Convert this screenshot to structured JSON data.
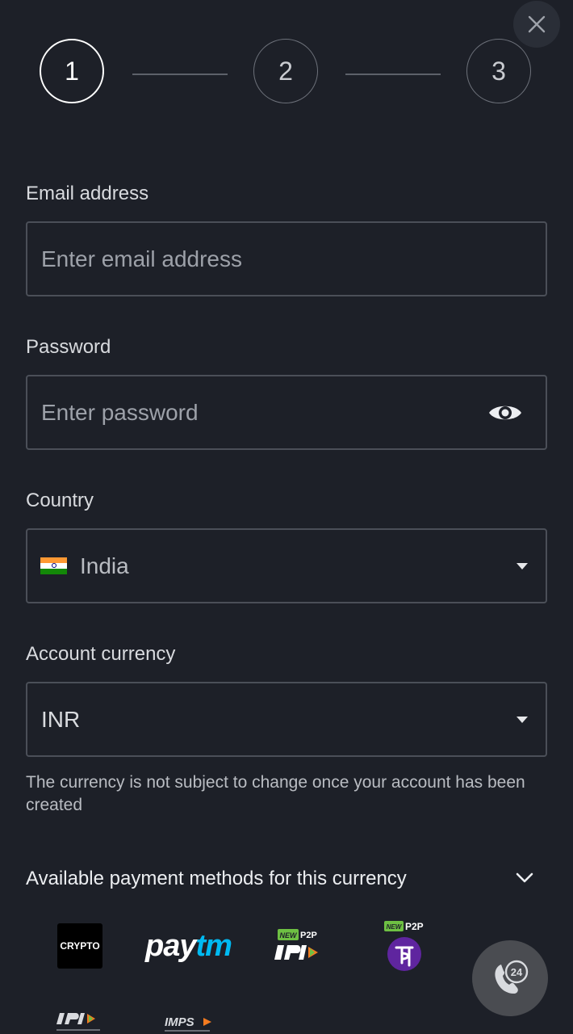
{
  "stepper": {
    "steps": [
      "1",
      "2",
      "3"
    ],
    "active_step": 1
  },
  "close_icon": "close-icon",
  "form": {
    "email": {
      "label": "Email address",
      "placeholder": "Enter email address",
      "value": ""
    },
    "password": {
      "label": "Password",
      "placeholder": "Enter password",
      "value": "",
      "toggle_icon": "eye-icon"
    },
    "country": {
      "label": "Country",
      "selected": "India",
      "flag_icon": "india-flag-icon"
    },
    "currency": {
      "label": "Account currency",
      "selected": "INR",
      "helper": "The currency is not subject to change once your account has been created"
    }
  },
  "payment_methods": {
    "title": "Available payment methods for this currency",
    "items": [
      {
        "name": "crypto",
        "label": "CRYPTO"
      },
      {
        "name": "paytm",
        "label_pay": "pay",
        "label_tm": "tm"
      },
      {
        "name": "upi-p2p",
        "badge": "NEW",
        "tag": "P2P"
      },
      {
        "name": "phonepe-p2p",
        "badge": "NEW",
        "tag": "P2P"
      },
      {
        "name": "upi"
      },
      {
        "name": "imps"
      }
    ]
  },
  "support_icon": "support-24-icon",
  "colors": {
    "background": "#1d2028",
    "border": "#4b4f58",
    "paytm_blue": "#00baf2",
    "phonepe_purple": "#5f259f",
    "upi_green": "#6ec043",
    "upi_orange": "#f47b20"
  }
}
